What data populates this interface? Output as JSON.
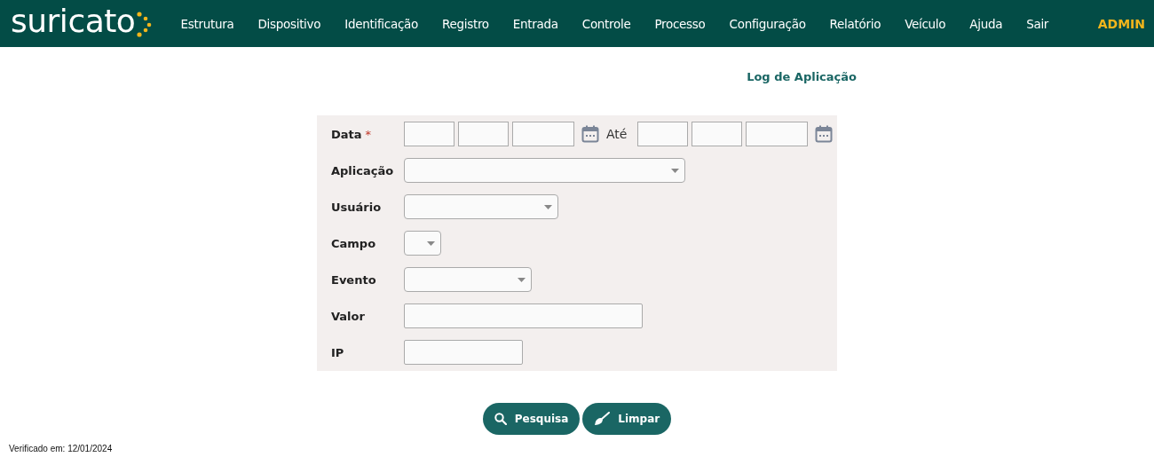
{
  "nav": {
    "logo": "suricato",
    "items": [
      "Estrutura",
      "Dispositivo",
      "Identificação",
      "Registro",
      "Entrada",
      "Controle",
      "Processo",
      "Configuração",
      "Relatório",
      "Veículo",
      "Ajuda",
      "Sair"
    ],
    "user": "ADMIN"
  },
  "page_title": "Log de Aplicação",
  "form": {
    "rows": [
      {
        "label": "Data",
        "required_mark": "*",
        "kind": "daterange",
        "separator": "Até"
      },
      {
        "label": "Aplicação",
        "kind": "select"
      },
      {
        "label": "Usuário",
        "kind": "select"
      },
      {
        "label": "Campo",
        "kind": "select"
      },
      {
        "label": "Evento",
        "kind": "select"
      },
      {
        "label": "Valor",
        "kind": "text"
      },
      {
        "label": "IP",
        "kind": "text"
      }
    ]
  },
  "buttons": [
    {
      "label": "Pesquisa",
      "kind": "search"
    },
    {
      "label": "Limpar",
      "kind": "clear"
    }
  ],
  "footer": "Verificado em: 12/01/2024"
}
